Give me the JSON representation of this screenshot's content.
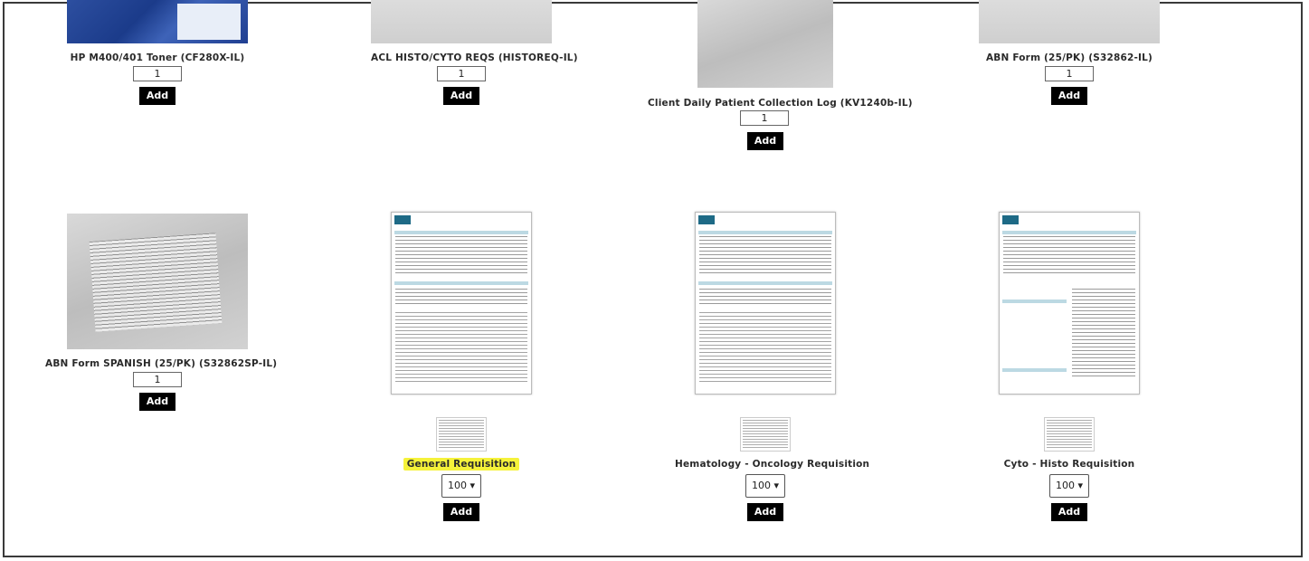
{
  "products_row1": [
    {
      "name": "HP M400/401 Toner (CF280X-IL)",
      "qty": "1",
      "add_label": "Add"
    },
    {
      "name": "ACL HISTO/CYTO REQS (HISTOREQ-IL)",
      "qty": "1",
      "add_label": "Add"
    },
    {
      "name": "Client Daily Patient Collection Log (KV1240b-IL)",
      "qty": "1",
      "add_label": "Add"
    },
    {
      "name": "ABN Form (25/PK) (S32862-IL)",
      "qty": "1",
      "add_label": "Add"
    }
  ],
  "products_row2": [
    {
      "name": "ABN Form SPANISH (25/PK) (S32862SP-IL)",
      "qty": "1",
      "add_label": "Add"
    },
    {
      "name": "General Requisition",
      "qty_select": "100 ▾",
      "add_label": "Add",
      "highlight_color": "#f5f23a"
    },
    {
      "name": "Hematology - Oncology Requisition",
      "qty_select": "100 ▾",
      "add_label": "Add"
    },
    {
      "name": "Cyto - Histo Requisition",
      "qty_select": "100 ▾",
      "add_label": "Add"
    }
  ],
  "colors": {
    "button_bg": "#000000",
    "highlight": "#f5f23a",
    "form_accent": "#1e6a86"
  }
}
